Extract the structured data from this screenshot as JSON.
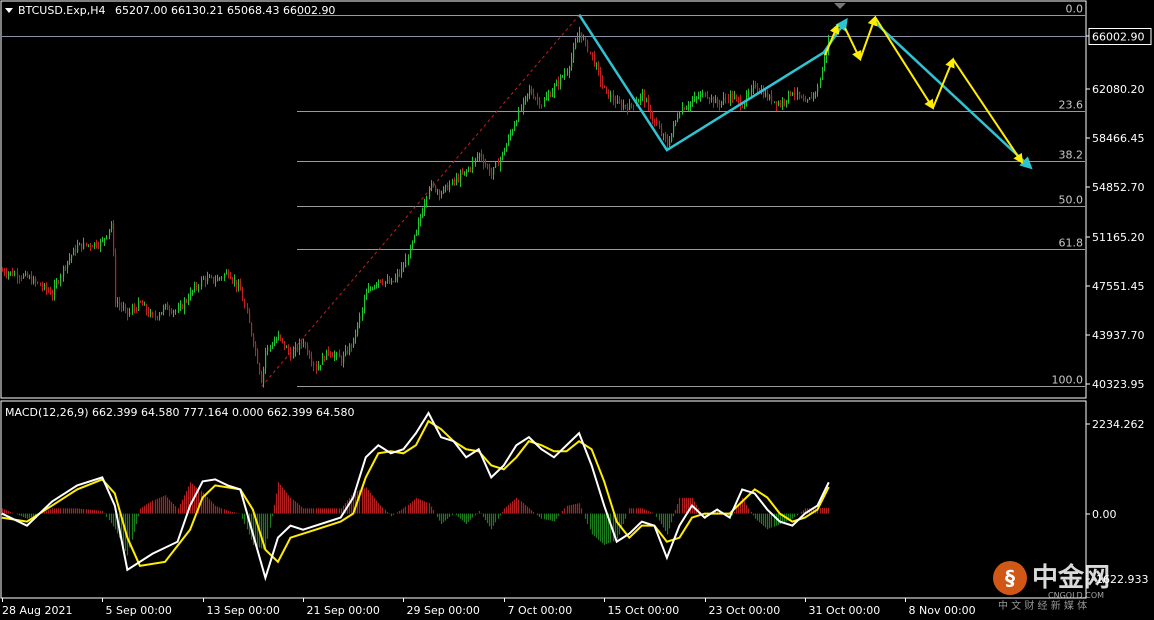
{
  "header": {
    "symbol_label": "BTCUSD.Exp,H4",
    "ohlc_label": "65207.00 66130.21 65068.43 66002.90"
  },
  "macd_label": "MACD(12,26,9) 662.399 64.580 777.164 0.000 662.399 64.580",
  "watermark": {
    "brand": "中金网",
    "domain": "CNGOLD.COM",
    "tagline": "中 文 财 经 新 媒 体"
  },
  "colors": {
    "background": "#000000",
    "bull": "#22c433",
    "bear": "#c02020",
    "fib": "#9a9a9a",
    "wave": "#2ec4d4",
    "arrow": "#ffee00",
    "macd_main": "#ffffff",
    "macd_signal": "#ffee00",
    "hist_pos": "#b02020",
    "hist_neg": "#1e7a1e"
  },
  "chart_data": [
    {
      "type": "candlestick",
      "title": "BTCUSD.Exp,H4",
      "price_axis_ticks": [
        "66002.90",
        "62080.20",
        "58466.45",
        "54852.70",
        "51165.20",
        "47551.45",
        "43937.70",
        "40323.95"
      ],
      "price_axis_values": [
        66002.9,
        62080.2,
        58466.45,
        54852.7,
        51165.2,
        47551.45,
        43937.7,
        40323.95
      ],
      "current_price": 66002.9,
      "ylim": [
        39300,
        68600
      ],
      "x_tick_labels": [
        "28 Aug 2021",
        "5 Sep 00:00",
        "13 Sep 00:00",
        "21 Sep 00:00",
        "29 Sep 00:00",
        "7 Oct 00:00",
        "15 Oct 00:00",
        "23 Oct 00:00",
        "31 Oct 00:00",
        "8 Nov 00:00"
      ],
      "fibonacci": {
        "levels": [
          {
            "label": "0.0",
            "price": 67550
          },
          {
            "label": "23.6",
            "price": 60500
          },
          {
            "label": "38.2",
            "price": 56800
          },
          {
            "label": "50.0",
            "price": 53500
          },
          {
            "label": "61.8",
            "price": 50280
          },
          {
            "label": "100.0",
            "price": 40150
          }
        ]
      },
      "close_path": [
        {
          "d": 0,
          "p": 48700
        },
        {
          "d": 2,
          "p": 48200
        },
        {
          "d": 4,
          "p": 47000
        },
        {
          "d": 5,
          "p": 49200
        },
        {
          "d": 6,
          "p": 50500
        },
        {
          "d": 8,
          "p": 50800
        },
        {
          "d": 8.7,
          "p": 52300
        },
        {
          "d": 9,
          "p": 46500
        },
        {
          "d": 10,
          "p": 45500
        },
        {
          "d": 11,
          "p": 46300
        },
        {
          "d": 12,
          "p": 45200
        },
        {
          "d": 13,
          "p": 46000
        },
        {
          "d": 14,
          "p": 45700
        },
        {
          "d": 15,
          "p": 47000
        },
        {
          "d": 16,
          "p": 48100
        },
        {
          "d": 17,
          "p": 48000
        },
        {
          "d": 18,
          "p": 48600
        },
        {
          "d": 19,
          "p": 47200
        },
        {
          "d": 20,
          "p": 43500
        },
        {
          "d": 20.7,
          "p": 40500
        },
        {
          "d": 21,
          "p": 42800
        },
        {
          "d": 22,
          "p": 43800
        },
        {
          "d": 23,
          "p": 42500
        },
        {
          "d": 24,
          "p": 43500
        },
        {
          "d": 25,
          "p": 41500
        },
        {
          "d": 26,
          "p": 42800
        },
        {
          "d": 27,
          "p": 42100
        },
        {
          "d": 28,
          "p": 43500
        },
        {
          "d": 29,
          "p": 47000
        },
        {
          "d": 30,
          "p": 48100
        },
        {
          "d": 31,
          "p": 47700
        },
        {
          "d": 32,
          "p": 49000
        },
        {
          "d": 33,
          "p": 51500
        },
        {
          "d": 34,
          "p": 55000
        },
        {
          "d": 35,
          "p": 54500
        },
        {
          "d": 36,
          "p": 55300
        },
        {
          "d": 37,
          "p": 56000
        },
        {
          "d": 38,
          "p": 57300
        },
        {
          "d": 39,
          "p": 55800
        },
        {
          "d": 40,
          "p": 57600
        },
        {
          "d": 41,
          "p": 60000
        },
        {
          "d": 42,
          "p": 62000
        },
        {
          "d": 43,
          "p": 61000
        },
        {
          "d": 44,
          "p": 62200
        },
        {
          "d": 45,
          "p": 63500
        },
        {
          "d": 46,
          "p": 66300
        },
        {
          "d": 47,
          "p": 64500
        },
        {
          "d": 48,
          "p": 62000
        },
        {
          "d": 49,
          "p": 61000
        },
        {
          "d": 50,
          "p": 60800
        },
        {
          "d": 51,
          "p": 61700
        },
        {
          "d": 52,
          "p": 59600
        },
        {
          "d": 53,
          "p": 58000
        },
        {
          "d": 54,
          "p": 60600
        },
        {
          "d": 55,
          "p": 61200
        },
        {
          "d": 56,
          "p": 61800
        },
        {
          "d": 57,
          "p": 61000
        },
        {
          "d": 58,
          "p": 61600
        },
        {
          "d": 59,
          "p": 61000
        },
        {
          "d": 60,
          "p": 62400
        },
        {
          "d": 61,
          "p": 61500
        },
        {
          "d": 62,
          "p": 61000
        },
        {
          "d": 63,
          "p": 62000
        },
        {
          "d": 64,
          "p": 60900
        },
        {
          "d": 65,
          "p": 62200
        },
        {
          "d": 65.9,
          "p": 66002.9
        }
      ],
      "wave_line": [
        {
          "d": 46,
          "p": 67600
        },
        {
          "d": 53,
          "p": 57600
        },
        {
          "d": 65.5,
          "p": 64800
        },
        {
          "d": 67.3,
          "p": 67200
        }
      ],
      "wave_projection": [
        {
          "d": 69.5,
          "p": 67100
        },
        {
          "d": 82,
          "p": 56300
        }
      ],
      "arrows": [
        [
          {
            "d": 65.6,
            "p": 64600
          },
          {
            "d": 66.6,
            "p": 66800
          }
        ],
        [
          {
            "d": 67.2,
            "p": 66600
          },
          {
            "d": 68.4,
            "p": 64300
          }
        ],
        [
          {
            "d": 68.4,
            "p": 64300
          },
          {
            "d": 69.6,
            "p": 67400
          }
        ],
        [
          {
            "d": 69.6,
            "p": 67400
          },
          {
            "d": 74.2,
            "p": 60700
          }
        ],
        [
          {
            "d": 74.2,
            "p": 60700
          },
          {
            "d": 75.8,
            "p": 64300
          }
        ],
        [
          {
            "d": 75.8,
            "p": 64300
          },
          {
            "d": 81.3,
            "p": 56700
          }
        ]
      ]
    },
    {
      "type": "macd",
      "title": "MACD(12,26,9) 662.399 64.580 777.164 0.000 662.399 64.580",
      "axis_ticks": [
        "2234.262",
        "0.00",
        "-1622.933"
      ],
      "axis_values": [
        2234.262,
        0,
        -1622.933
      ],
      "ylim": [
        -2100,
        2800
      ],
      "main_line": [
        {
          "d": 0,
          "v": 0
        },
        {
          "d": 2,
          "v": -300
        },
        {
          "d": 4,
          "v": 300
        },
        {
          "d": 6,
          "v": 700
        },
        {
          "d": 8,
          "v": 900
        },
        {
          "d": 9,
          "v": 200
        },
        {
          "d": 10,
          "v": -1400
        },
        {
          "d": 12,
          "v": -1000
        },
        {
          "d": 14,
          "v": -700
        },
        {
          "d": 15,
          "v": 200
        },
        {
          "d": 16,
          "v": 800
        },
        {
          "d": 17,
          "v": 850
        },
        {
          "d": 18,
          "v": 700
        },
        {
          "d": 19,
          "v": 600
        },
        {
          "d": 20,
          "v": -500
        },
        {
          "d": 21,
          "v": -1600
        },
        {
          "d": 22,
          "v": -600
        },
        {
          "d": 23,
          "v": -300
        },
        {
          "d": 24,
          "v": -400
        },
        {
          "d": 26,
          "v": -200
        },
        {
          "d": 27,
          "v": -100
        },
        {
          "d": 28,
          "v": 400
        },
        {
          "d": 29,
          "v": 1400
        },
        {
          "d": 30,
          "v": 1700
        },
        {
          "d": 31,
          "v": 1500
        },
        {
          "d": 32,
          "v": 1600
        },
        {
          "d": 33,
          "v": 2000
        },
        {
          "d": 34,
          "v": 2500
        },
        {
          "d": 35,
          "v": 1900
        },
        {
          "d": 36,
          "v": 1800
        },
        {
          "d": 37,
          "v": 1400
        },
        {
          "d": 38,
          "v": 1600
        },
        {
          "d": 39,
          "v": 900
        },
        {
          "d": 40,
          "v": 1200
        },
        {
          "d": 41,
          "v": 1700
        },
        {
          "d": 42,
          "v": 1900
        },
        {
          "d": 43,
          "v": 1600
        },
        {
          "d": 44,
          "v": 1400
        },
        {
          "d": 45,
          "v": 1700
        },
        {
          "d": 46,
          "v": 2000
        },
        {
          "d": 47,
          "v": 1200
        },
        {
          "d": 48,
          "v": 200
        },
        {
          "d": 49,
          "v": -700
        },
        {
          "d": 50,
          "v": -500
        },
        {
          "d": 51,
          "v": -200
        },
        {
          "d": 52,
          "v": -300
        },
        {
          "d": 53,
          "v": -1100
        },
        {
          "d": 54,
          "v": -300
        },
        {
          "d": 55,
          "v": 200
        },
        {
          "d": 56,
          "v": -100
        },
        {
          "d": 57,
          "v": 100
        },
        {
          "d": 58,
          "v": -100
        },
        {
          "d": 59,
          "v": 600
        },
        {
          "d": 60,
          "v": 500
        },
        {
          "d": 61,
          "v": 100
        },
        {
          "d": 62,
          "v": -200
        },
        {
          "d": 63,
          "v": -300
        },
        {
          "d": 64,
          "v": 0
        },
        {
          "d": 65,
          "v": 200
        },
        {
          "d": 65.9,
          "v": 777
        }
      ],
      "signal_line": [
        {
          "d": 0,
          "v": -100
        },
        {
          "d": 2,
          "v": -200
        },
        {
          "d": 4,
          "v": 200
        },
        {
          "d": 6,
          "v": 600
        },
        {
          "d": 8,
          "v": 850
        },
        {
          "d": 9,
          "v": 500
        },
        {
          "d": 10,
          "v": -600
        },
        {
          "d": 11,
          "v": -1300
        },
        {
          "d": 13,
          "v": -1200
        },
        {
          "d": 15,
          "v": -400
        },
        {
          "d": 16,
          "v": 400
        },
        {
          "d": 17,
          "v": 700
        },
        {
          "d": 19,
          "v": 600
        },
        {
          "d": 20,
          "v": 100
        },
        {
          "d": 21,
          "v": -900
        },
        {
          "d": 22,
          "v": -1200
        },
        {
          "d": 23,
          "v": -600
        },
        {
          "d": 25,
          "v": -400
        },
        {
          "d": 27,
          "v": -200
        },
        {
          "d": 28,
          "v": 0
        },
        {
          "d": 29,
          "v": 900
        },
        {
          "d": 30,
          "v": 1500
        },
        {
          "d": 31,
          "v": 1550
        },
        {
          "d": 32,
          "v": 1500
        },
        {
          "d": 33,
          "v": 1700
        },
        {
          "d": 34,
          "v": 2300
        },
        {
          "d": 35,
          "v": 2100
        },
        {
          "d": 36,
          "v": 1800
        },
        {
          "d": 37,
          "v": 1600
        },
        {
          "d": 38,
          "v": 1550
        },
        {
          "d": 39,
          "v": 1200
        },
        {
          "d": 40,
          "v": 1100
        },
        {
          "d": 41,
          "v": 1400
        },
        {
          "d": 42,
          "v": 1800
        },
        {
          "d": 43,
          "v": 1700
        },
        {
          "d": 44,
          "v": 1550
        },
        {
          "d": 45,
          "v": 1550
        },
        {
          "d": 46,
          "v": 1800
        },
        {
          "d": 47,
          "v": 1600
        },
        {
          "d": 48,
          "v": 800
        },
        {
          "d": 49,
          "v": -200
        },
        {
          "d": 50,
          "v": -600
        },
        {
          "d": 51,
          "v": -300
        },
        {
          "d": 52,
          "v": -300
        },
        {
          "d": 53,
          "v": -700
        },
        {
          "d": 54,
          "v": -600
        },
        {
          "d": 55,
          "v": -100
        },
        {
          "d": 56,
          "v": 0
        },
        {
          "d": 57,
          "v": 0
        },
        {
          "d": 58,
          "v": 0
        },
        {
          "d": 59,
          "v": 300
        },
        {
          "d": 60,
          "v": 600
        },
        {
          "d": 61,
          "v": 400
        },
        {
          "d": 62,
          "v": 0
        },
        {
          "d": 63,
          "v": -200
        },
        {
          "d": 64,
          "v": -100
        },
        {
          "d": 65,
          "v": 100
        },
        {
          "d": 65.9,
          "v": 662
        }
      ]
    }
  ]
}
